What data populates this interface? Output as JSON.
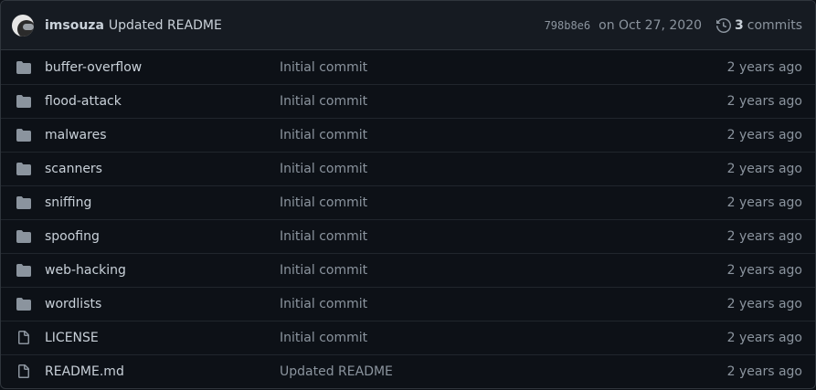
{
  "latest_commit": {
    "author": "imsouza",
    "message": "Updated README",
    "sha": "798b8e6",
    "date": "on Oct 27, 2020",
    "commit_count": "3",
    "commits_label": "commits"
  },
  "files": [
    {
      "name": "buffer-overflow",
      "type": "folder",
      "message": "Initial commit",
      "age": "2 years ago"
    },
    {
      "name": "flood-attack",
      "type": "folder",
      "message": "Initial commit",
      "age": "2 years ago"
    },
    {
      "name": "malwares",
      "type": "folder",
      "message": "Initial commit",
      "age": "2 years ago"
    },
    {
      "name": "scanners",
      "type": "folder",
      "message": "Initial commit",
      "age": "2 years ago"
    },
    {
      "name": "sniffing",
      "type": "folder",
      "message": "Initial commit",
      "age": "2 years ago"
    },
    {
      "name": "spoofing",
      "type": "folder",
      "message": "Initial commit",
      "age": "2 years ago"
    },
    {
      "name": "web-hacking",
      "type": "folder",
      "message": "Initial commit",
      "age": "2 years ago"
    },
    {
      "name": "wordlists",
      "type": "folder",
      "message": "Initial commit",
      "age": "2 years ago"
    },
    {
      "name": "LICENSE",
      "type": "file",
      "message": "Initial commit",
      "age": "2 years ago"
    },
    {
      "name": "README.md",
      "type": "file",
      "message": "Updated README",
      "age": "2 years ago"
    }
  ],
  "colors": {
    "background": "#0d1117",
    "header_bg": "#161b22",
    "border": "#30363d",
    "text": "#c9d1d9",
    "muted": "#8b949e",
    "folder_icon": "#8b949e"
  }
}
